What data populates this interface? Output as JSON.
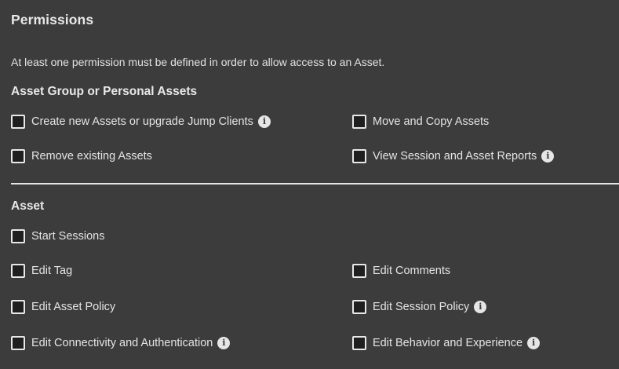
{
  "page": {
    "title": "Permissions",
    "notice": "At least one permission must be defined in order to allow access to an Asset."
  },
  "asset_group_section": {
    "title": "Asset Group or Personal Assets",
    "permissions": [
      {
        "label": "Create new Assets or upgrade Jump Clients",
        "checked": false,
        "info_icon": true
      },
      {
        "label": "Move and Copy Assets",
        "checked": false,
        "info_icon": false
      },
      {
        "label": "Remove existing Assets",
        "checked": false,
        "info_icon": false
      },
      {
        "label": "View Session and Asset Reports",
        "checked": false,
        "info_icon": true
      }
    ]
  },
  "asset_section": {
    "title": "Asset",
    "permissions": [
      {
        "label": "Start Sessions",
        "checked": false,
        "info_icon": false
      },
      {
        "label": "Edit Tag",
        "checked": false,
        "info_icon": false
      },
      {
        "label": "Edit Comments",
        "checked": false,
        "info_icon": false
      },
      {
        "label": "Edit Asset Policy",
        "checked": false,
        "info_icon": false
      },
      {
        "label": "Edit Session Policy",
        "checked": false,
        "info_icon": true
      },
      {
        "label": "Edit Connectivity and Authentication",
        "checked": false,
        "info_icon": true
      },
      {
        "label": "Edit Behavior and Experience",
        "checked": false,
        "info_icon": true
      }
    ]
  },
  "icons": {
    "info": "info-icon",
    "info_glyph": "i"
  },
  "colors": {
    "background": "#3c3c3c",
    "text": "#e4e4e4",
    "checkbox_border": "#e8e8e8",
    "checkbox_fill": "#1f1f1f"
  }
}
